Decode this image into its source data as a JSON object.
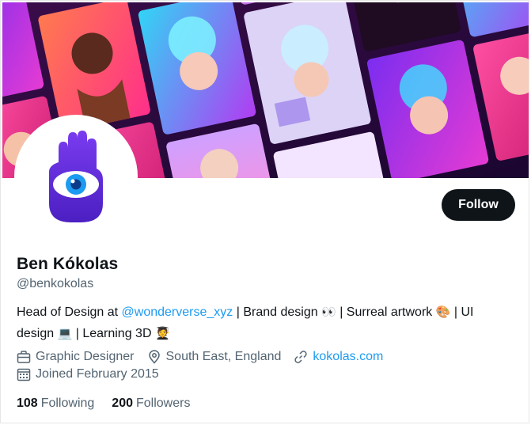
{
  "profile": {
    "display_name": "Ben Kókolas",
    "handle": "@benkokolas",
    "follow_label": "Follow"
  },
  "bio": {
    "text_1": "Head of Design at ",
    "mention": "@wonderverse_xyz",
    "text_2": " | Brand design ",
    "emoji_eyes": "👀",
    "text_3": " | Surreal artwork ",
    "emoji_palette": "🎨",
    "text_4": " | UI design ",
    "emoji_laptop": "💻",
    "text_5": " | Learning 3D ",
    "emoji_student": "🧑‍🎓"
  },
  "meta": {
    "profession": "Graphic Designer",
    "location": "South East, England",
    "website": "kokolas.com",
    "joined": "Joined February 2015"
  },
  "stats": {
    "following_count": "108",
    "following_label": "Following",
    "followers_count": "200",
    "followers_label": "Followers"
  },
  "colors": {
    "accent": "#1d9bf0",
    "text": "#0f1419",
    "secondary": "#536471",
    "button_bg": "#0f1419",
    "avatar_purple": "#6b2fd6"
  }
}
